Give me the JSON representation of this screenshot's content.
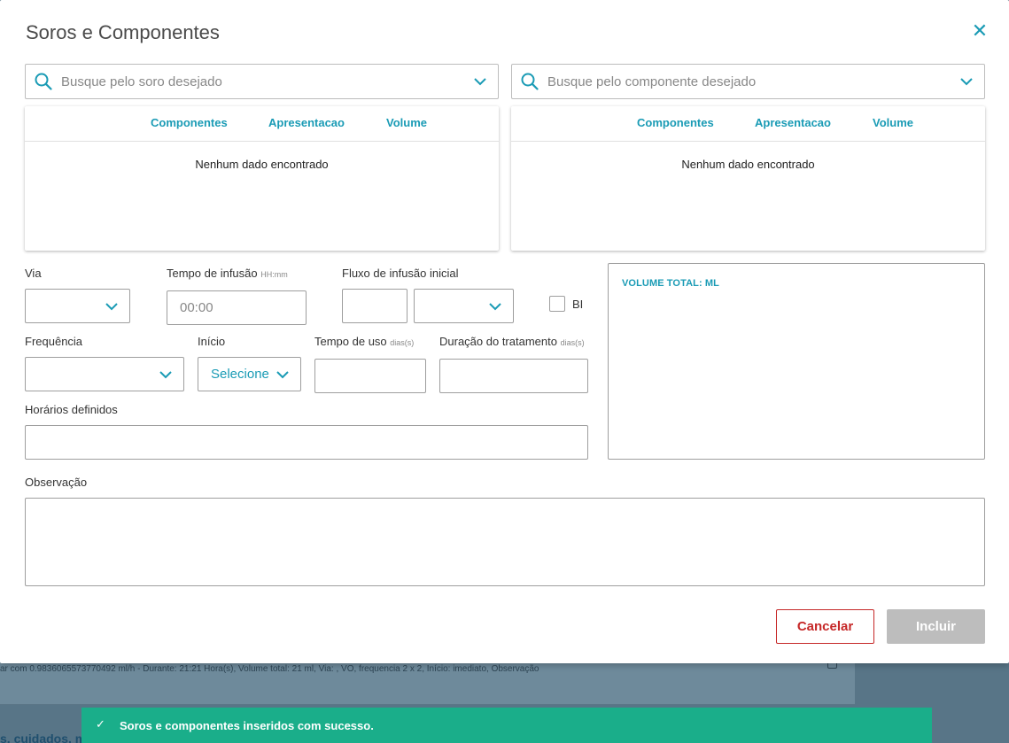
{
  "background": {
    "row_text": "ar com 0.9836065573770492 ml/h - Durante: 21:21 Hora(s), Volume total: 21 ml, Via: , VO, frequencia 2 x 2, Início: imediato, Observação",
    "bottom_text": "s, cuidados, m"
  },
  "modal": {
    "title": "Soros e Componentes",
    "close_icon": "close-icon"
  },
  "soro_search": {
    "placeholder": "Busque pelo soro desejado",
    "columns": [
      "Componentes",
      "Apresentacao",
      "Volume"
    ],
    "empty_message": "Nenhum dado encontrado"
  },
  "componente_search": {
    "placeholder": "Busque pelo componente desejado",
    "columns": [
      "Componentes",
      "Apresentacao",
      "Volume"
    ],
    "empty_message": "Nenhum dado encontrado"
  },
  "form": {
    "via_label": "Via",
    "via_value": "",
    "tempo_infusao_label": "Tempo de infusão",
    "tempo_infusao_hint": "HH:mm",
    "tempo_infusao_placeholder": "00:00",
    "fluxo_label": "Fluxo de infusão inicial",
    "fluxo_value": "",
    "fluxo_unit": "",
    "bi_label": "BI",
    "bi_checked": false,
    "frequencia_label": "Frequência",
    "frequencia_value": "",
    "inicio_label": "Início",
    "inicio_value": "Selecione",
    "tempo_uso_label": "Tempo de uso",
    "tempo_uso_hint": "dias(s)",
    "tempo_uso_value": "",
    "duracao_label": "Duração do tratamento",
    "duracao_hint": "dias(s)",
    "duracao_value": "",
    "horarios_label": "Horários definidos",
    "horarios_value": "",
    "observacao_label": "Observação",
    "observacao_value": ""
  },
  "volume_total_label": "VOLUME TOTAL: ML",
  "buttons": {
    "cancel": "Cancelar",
    "include": "Incluir"
  },
  "toast": {
    "message": "Soros e componentes inseridos com sucesso."
  },
  "colors": {
    "accent": "#1a9bb5",
    "danger": "#c62828",
    "success": "#1aae8a",
    "disabled": "#bdbdbd"
  }
}
